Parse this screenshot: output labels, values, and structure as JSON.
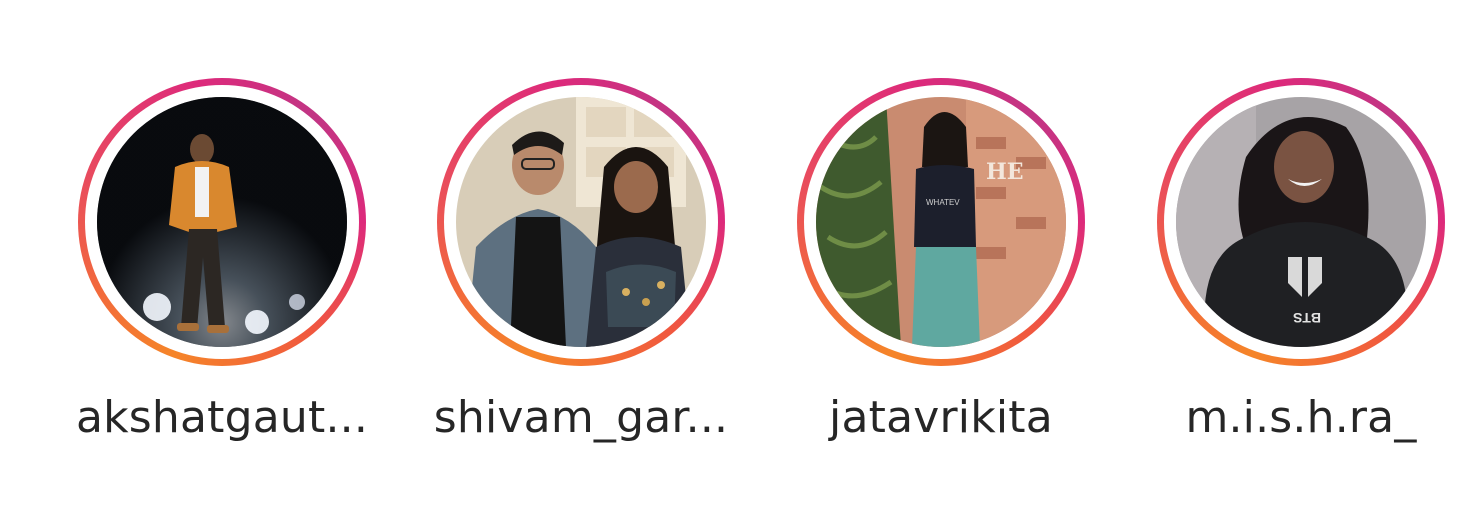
{
  "stories": [
    {
      "username": "akshatgaut...",
      "avatar_icon": "profile-photo-man-orange-jacket-night-stage",
      "has_unseen_story": true
    },
    {
      "username": "shivam_gar...",
      "avatar_icon": "profile-photo-couple-event",
      "has_unseen_story": true
    },
    {
      "username": "jatavrikita",
      "avatar_icon": "profile-photo-woman-plants-brick-wall",
      "has_unseen_story": true
    },
    {
      "username": "m.i.s.h.ra_",
      "avatar_icon": "profile-photo-woman-bts-hoodie",
      "has_unseen_story": true
    }
  ],
  "colors": {
    "ring_start": "#f58529",
    "ring_mid": "#dd2a7b",
    "ring_end": "#c13584",
    "username_text": "#262626",
    "background": "#ffffff"
  }
}
